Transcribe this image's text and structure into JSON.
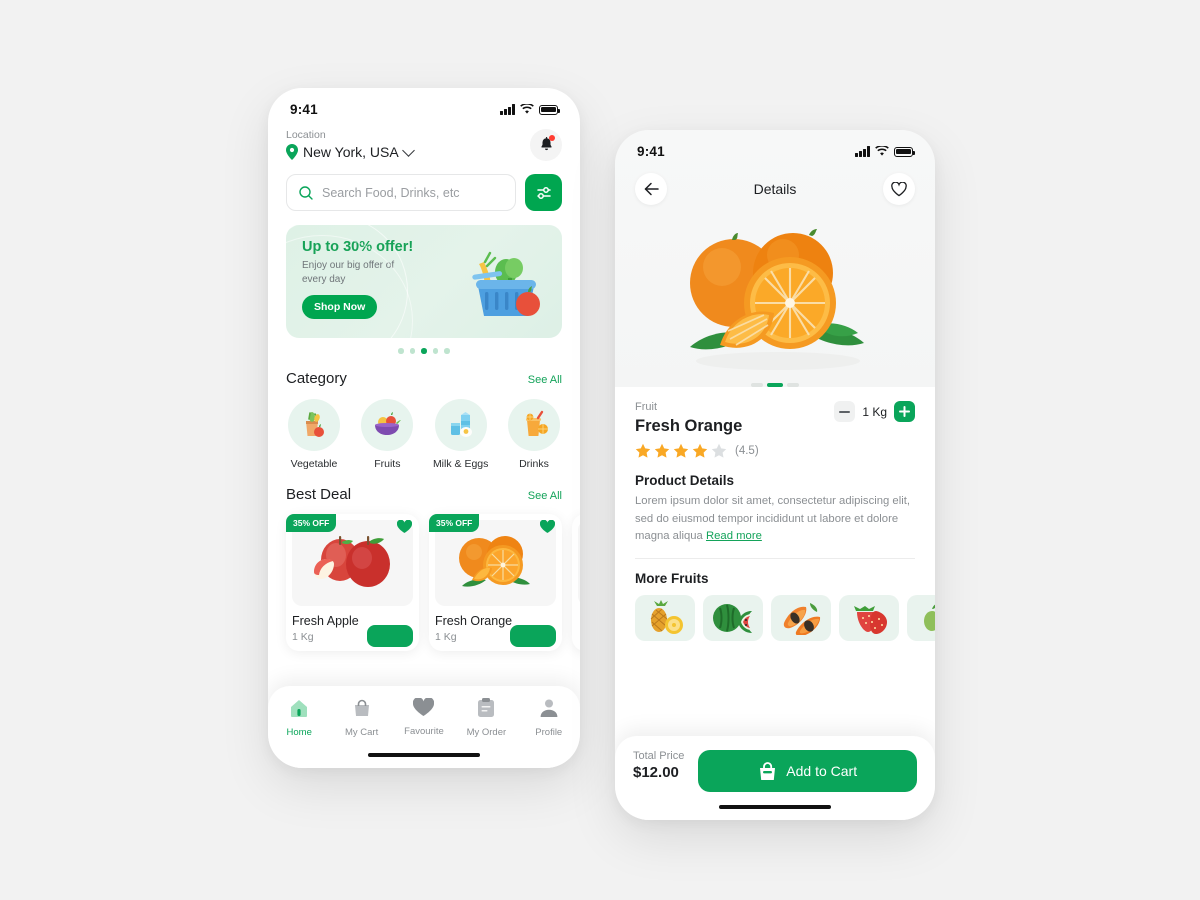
{
  "home": {
    "status": {
      "time": "9:41"
    },
    "location": {
      "label": "Location",
      "value": "New York, USA"
    },
    "search": {
      "placeholder": "Search Food, Drinks, etc"
    },
    "banner": {
      "title": "Up to 30% offer!",
      "subtitle": "Enjoy our big offer of every day",
      "cta": "Shop Now",
      "dots": 5,
      "active_dot": 3
    },
    "category": {
      "title": "Category",
      "see_all": "See All",
      "items": [
        {
          "label": "Vegetable",
          "icon": "vegetable-icon"
        },
        {
          "label": "Fruits",
          "icon": "fruits-bowl-icon"
        },
        {
          "label": "Milk & Eggs",
          "icon": "milk-eggs-icon"
        },
        {
          "label": "Drinks",
          "icon": "drinks-icon"
        }
      ]
    },
    "best_deal": {
      "title": "Best Deal",
      "see_all": "See All",
      "items": [
        {
          "name": "Fresh Apple",
          "weight": "1 Kg",
          "discount": "35% OFF",
          "image": "apple-image"
        },
        {
          "name": "Fresh Orange",
          "weight": "1 Kg",
          "discount": "35% OFF",
          "image": "orange-image"
        },
        {
          "name": "",
          "weight": "",
          "discount": "",
          "image": "partial-card"
        }
      ]
    },
    "tabs": [
      {
        "label": "Home",
        "icon": "home-icon",
        "active": true
      },
      {
        "label": "My Cart",
        "icon": "bag-icon",
        "active": false
      },
      {
        "label": "Favourite",
        "icon": "heart-icon",
        "active": false
      },
      {
        "label": "My Order",
        "icon": "clipboard-icon",
        "active": false
      },
      {
        "label": "Profile",
        "icon": "person-icon",
        "active": false
      }
    ]
  },
  "details": {
    "status": {
      "time": "9:41"
    },
    "title": "Details",
    "hero": {
      "image": "orange-hero-image",
      "dots": 3,
      "active_dot": 2
    },
    "product": {
      "category": "Fruit",
      "name": "Fresh Orange",
      "stars_filled": 4,
      "stars_total": 5,
      "rating": "(4.5)",
      "quantity": "1 Kg",
      "minus": "−",
      "plus": "+"
    },
    "product_details": {
      "title": "Product Details",
      "text": "Lorem ipsum dolor sit amet, consectetur adipiscing elit, sed do eiusmod tempor incididunt ut labore et dolore magna aliqua ",
      "read_more": "Read more"
    },
    "more_fruits": {
      "title": "More Fruits",
      "items": [
        {
          "name": "pineapple-image"
        },
        {
          "name": "watermelon-image"
        },
        {
          "name": "papaya-image"
        },
        {
          "name": "strawberry-image"
        },
        {
          "name": "partial-tile-image"
        }
      ]
    },
    "bottom": {
      "total_label": "Total Price",
      "total_value": "$12.00",
      "cta": "Add to Cart"
    }
  },
  "colors": {
    "brand_green": "#0aa55a",
    "brand_green_dark": "#00a650",
    "banner_bg": "#ddf0e6",
    "category_bg": "#e7f4ee",
    "star_gold": "#f9a825",
    "muted_text": "#8b8f93",
    "page_bg": "#f2f2f2"
  }
}
